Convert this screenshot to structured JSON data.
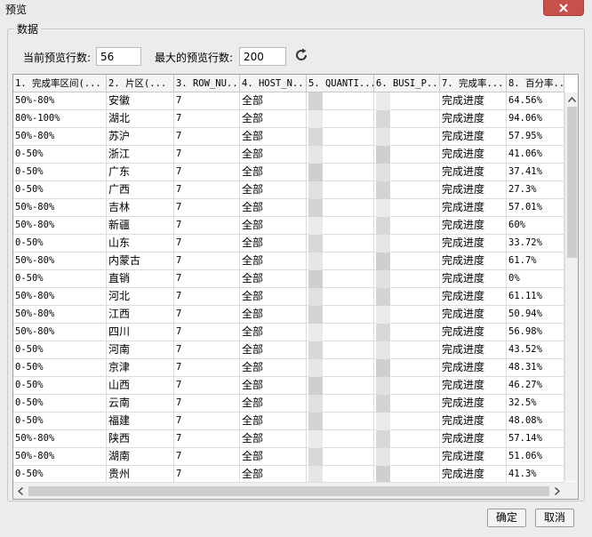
{
  "window": {
    "title": "预览"
  },
  "group": {
    "legend": "数据"
  },
  "controls": {
    "current_rows_label": "当前预览行数:",
    "current_rows_value": "56",
    "max_rows_label": "最大的预览行数:",
    "max_rows_value": "200"
  },
  "table": {
    "headers": [
      "1. 完成率区间(...",
      "2. 片区(...",
      "3. ROW_NU...",
      "4. HOST_N...",
      "5. QUANTI...",
      "6. BUSI_P...",
      "7. 完成率...",
      "8. 百分率..."
    ],
    "rows": [
      [
        "50%-80%",
        "安徽",
        "7",
        "全部",
        "",
        "",
        "完成进度",
        "64.56%"
      ],
      [
        "80%-100%",
        "湖北",
        "7",
        "全部",
        "",
        "",
        "完成进度",
        "94.06%"
      ],
      [
        "50%-80%",
        "苏沪",
        "7",
        "全部",
        "",
        "",
        "完成进度",
        "57.95%"
      ],
      [
        "0-50%",
        "浙江",
        "7",
        "全部",
        "",
        "",
        "完成进度",
        "41.06%"
      ],
      [
        "0-50%",
        "广东",
        "7",
        "全部",
        "",
        "",
        "完成进度",
        "37.41%"
      ],
      [
        "0-50%",
        "广西",
        "7",
        "全部",
        "",
        "",
        "完成进度",
        "27.3%"
      ],
      [
        "50%-80%",
        "吉林",
        "7",
        "全部",
        "",
        "",
        "完成进度",
        "57.01%"
      ],
      [
        "50%-80%",
        "新疆",
        "7",
        "全部",
        "",
        "",
        "完成进度",
        "60%"
      ],
      [
        "0-50%",
        "山东",
        "7",
        "全部",
        "",
        "",
        "完成进度",
        "33.72%"
      ],
      [
        "50%-80%",
        "内蒙古",
        "7",
        "全部",
        "",
        "",
        "完成进度",
        "61.7%"
      ],
      [
        "0-50%",
        "直销",
        "7",
        "全部",
        "",
        "",
        "完成进度",
        "0%"
      ],
      [
        "50%-80%",
        "河北",
        "7",
        "全部",
        "",
        "",
        "完成进度",
        "61.11%"
      ],
      [
        "50%-80%",
        "江西",
        "7",
        "全部",
        "",
        "",
        "完成进度",
        "50.94%"
      ],
      [
        "50%-80%",
        "四川",
        "7",
        "全部",
        "",
        "",
        "完成进度",
        "56.98%"
      ],
      [
        "0-50%",
        "河南",
        "7",
        "全部",
        "",
        "",
        "完成进度",
        "43.52%"
      ],
      [
        "0-50%",
        "京津",
        "7",
        "全部",
        "",
        "",
        "完成进度",
        "48.31%"
      ],
      [
        "0-50%",
        "山西",
        "7",
        "全部",
        "",
        "",
        "完成进度",
        "46.27%"
      ],
      [
        "0-50%",
        "云南",
        "7",
        "全部",
        "",
        "",
        "完成进度",
        "32.5%"
      ],
      [
        "0-50%",
        "福建",
        "7",
        "全部",
        "",
        "",
        "完成进度",
        "48.08%"
      ],
      [
        "50%-80%",
        "陕西",
        "7",
        "全部",
        "",
        "",
        "完成进度",
        "57.14%"
      ],
      [
        "50%-80%",
        "湖南",
        "7",
        "全部",
        "",
        "",
        "完成进度",
        "51.06%"
      ],
      [
        "0-50%",
        "贵州",
        "7",
        "全部",
        "",
        "",
        "完成进度",
        "41.3%"
      ]
    ]
  },
  "buttons": {
    "ok": "确定",
    "cancel": "取消"
  },
  "icons": {
    "close": "close-icon",
    "refresh": "refresh-icon"
  },
  "colors": {
    "close_button": "#c7504a"
  }
}
